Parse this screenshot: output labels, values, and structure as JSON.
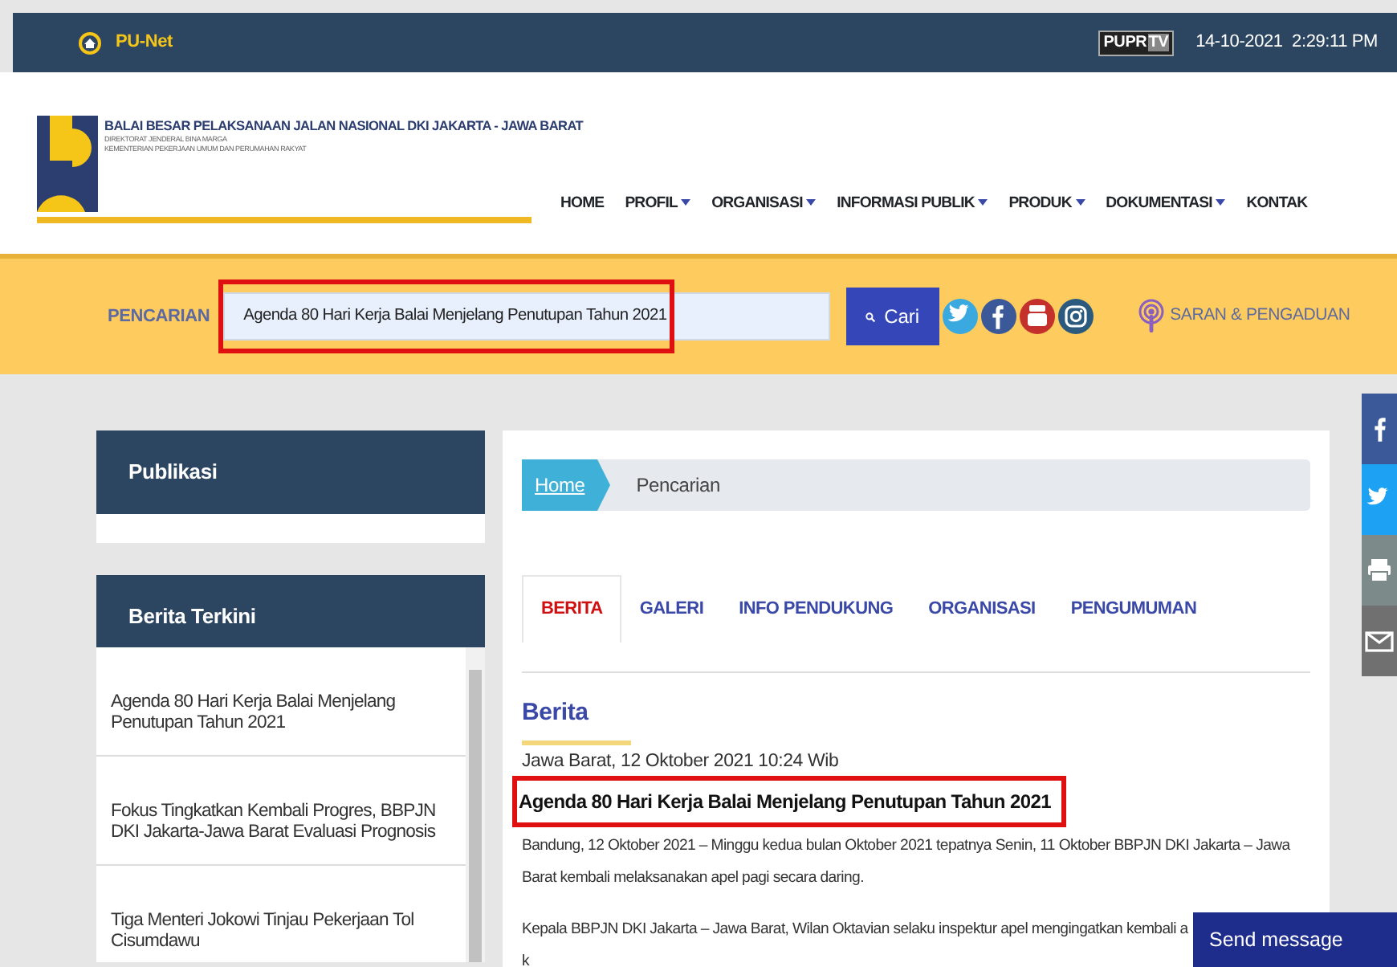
{
  "topbar": {
    "brand": "PU-Net",
    "tv_logo": [
      "PUPR",
      "TV"
    ],
    "datetime": "14-10-2021  2:29:11 PM"
  },
  "header": {
    "title": "BALAI BESAR PELAKSANAAN JALAN NASIONAL DKI JAKARTA - JAWA BARAT",
    "subtitles": [
      "DIREKTORAT JENDERAL BINA MARGA",
      "KEMENTERIAN PEKERJAAN UMUM DAN PERUMAHAN RAKYAT"
    ],
    "nav": [
      {
        "label": "HOME",
        "dropdown": false
      },
      {
        "label": "PROFIL",
        "dropdown": true
      },
      {
        "label": "ORGANISASI",
        "dropdown": true
      },
      {
        "label": "INFORMASI PUBLIK",
        "dropdown": true
      },
      {
        "label": "PRODUK",
        "dropdown": true
      },
      {
        "label": "DOKUMENTASI",
        "dropdown": true
      },
      {
        "label": "KONTAK",
        "dropdown": false
      }
    ]
  },
  "search": {
    "label": "PENCARIAN",
    "value": "Agenda 80 Hari Kerja Balai Menjelang Penutupan Tahun 2021",
    "highlighted": true,
    "button": "Cari",
    "socials": [
      {
        "kind": "twitter",
        "color": "#3aa9e0"
      },
      {
        "kind": "facebook",
        "color": "#3b5998"
      },
      {
        "kind": "youtube",
        "color": "#c4302b"
      },
      {
        "kind": "instagram",
        "color": "#2b5a7e"
      }
    ],
    "feedback": "SARAN & PENGADUAN"
  },
  "sidebar": {
    "publikasi": {
      "title": "Publikasi"
    },
    "berita_terkini": {
      "title": "Berita Terkini",
      "items": [
        "Agenda 80 Hari Kerja Balai Menjelang Penutupan Tahun 2021",
        "Fokus Tingkatkan Kembali Progres, BBPJN DKI Jakarta-Jawa Barat Evaluasi Prognosis",
        "Tiga Menteri Jokowi Tinjau Pekerjaan Tol Cisumdawu"
      ]
    }
  },
  "breadcrumb": [
    "Home",
    "Pencarian"
  ],
  "tabs": [
    {
      "label": "BERITA",
      "selected": true
    },
    {
      "label": "GALERI",
      "selected": false
    },
    {
      "label": "INFO PENDUKUNG",
      "selected": false
    },
    {
      "label": "ORGANISASI",
      "selected": false
    },
    {
      "label": "PENGUMUMAN",
      "selected": false
    }
  ],
  "article": {
    "section": "Berita",
    "date": "Jawa Barat, 12 Oktober 2021 10:24 Wib",
    "title": "Agenda 80 Hari Kerja Balai Menjelang Penutupan Tahun 2021",
    "highlighted": true,
    "paragraphs": [
      [
        "Bandung, 12 Oktober 2021 – Minggu kedua bulan Oktober 2021 tepatnya Senin, 11 Oktober BBPJN DKI Jakarta – Jawa",
        "Barat kembali melaksanakan apel pagi secara daring."
      ],
      [
        "Kepala BBPJN DKI Jakarta – Jawa Barat, Wilan Oktavian selaku inspektur apel mengingatkan kembali a",
        "k"
      ]
    ]
  },
  "share_bar": [
    {
      "kind": "facebook",
      "color": "#3b5998"
    },
    {
      "kind": "twitter",
      "color": "#1da1f2"
    },
    {
      "kind": "print",
      "color": "#7d8a8a"
    },
    {
      "kind": "email",
      "color": "#707070"
    }
  ],
  "chat": {
    "label": "Send message"
  }
}
